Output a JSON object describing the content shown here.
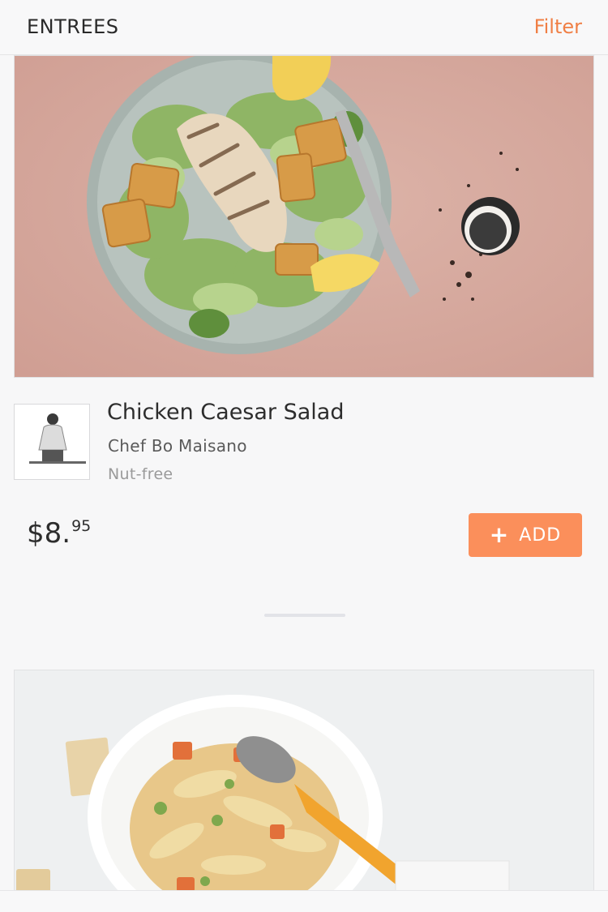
{
  "header": {
    "title": "ENTREES",
    "filter_label": "Filter"
  },
  "items": [
    {
      "name": "Chicken Caesar Salad",
      "chef": "Chef Bo Maisano",
      "tag": "Nut-free",
      "price_main": "$8.",
      "price_cents": "95",
      "add_label": "ADD",
      "add_icon": "plus-icon"
    }
  ],
  "colors": {
    "accent": "#f07f45",
    "add_button": "#fb8f5b",
    "background": "#f7f7f8"
  }
}
